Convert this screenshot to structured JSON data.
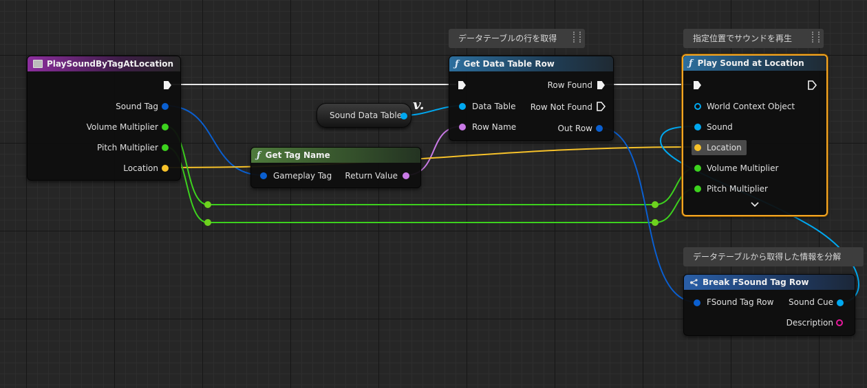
{
  "colors": {
    "exec": "#f2f2f2",
    "object": "#00a8f0",
    "struct": "#0a5fd0",
    "float": "#3dd21e",
    "vector": "#f7c22a",
    "name": "#c97ae6",
    "text": "#e8189c",
    "gameplay_tag": "#0a5fd0"
  },
  "comments": {
    "get_row": "データテーブルの行を取得",
    "play_sound": "指定位置でサウンドを再生",
    "break_row": "データテーブルから取得した情報を分解"
  },
  "event_node": {
    "icon": "event-icon",
    "title": "PlaySoundByTagAtLocation",
    "pins": [
      "Sound Tag",
      "Volume Multiplier",
      "Pitch Multiplier",
      "Location"
    ]
  },
  "variable_node": {
    "label": "Sound Data Table"
  },
  "get_data_table_row": {
    "icon": "function-icon",
    "title": "Get Data Table Row",
    "inputs": [
      "Data Table",
      "Row Name"
    ],
    "outputs": [
      "Row Found",
      "Row Not Found",
      "Out Row"
    ]
  },
  "get_tag_name": {
    "icon": "function-icon",
    "title": "Get Tag Name",
    "input": "Gameplay Tag",
    "output": "Return Value"
  },
  "play_sound_at_location": {
    "icon": "function-icon",
    "title": "Play Sound at Location",
    "inputs": [
      "World Context Object",
      "Sound",
      "Location",
      "Volume Multiplier",
      "Pitch Multiplier"
    ],
    "expand_icon": "chevron-down-icon"
  },
  "break_row": {
    "icon": "break-struct-icon",
    "title": "Break FSound Tag Row",
    "input": "FSound Tag Row",
    "outputs": [
      "Sound Cue",
      "Description"
    ]
  }
}
